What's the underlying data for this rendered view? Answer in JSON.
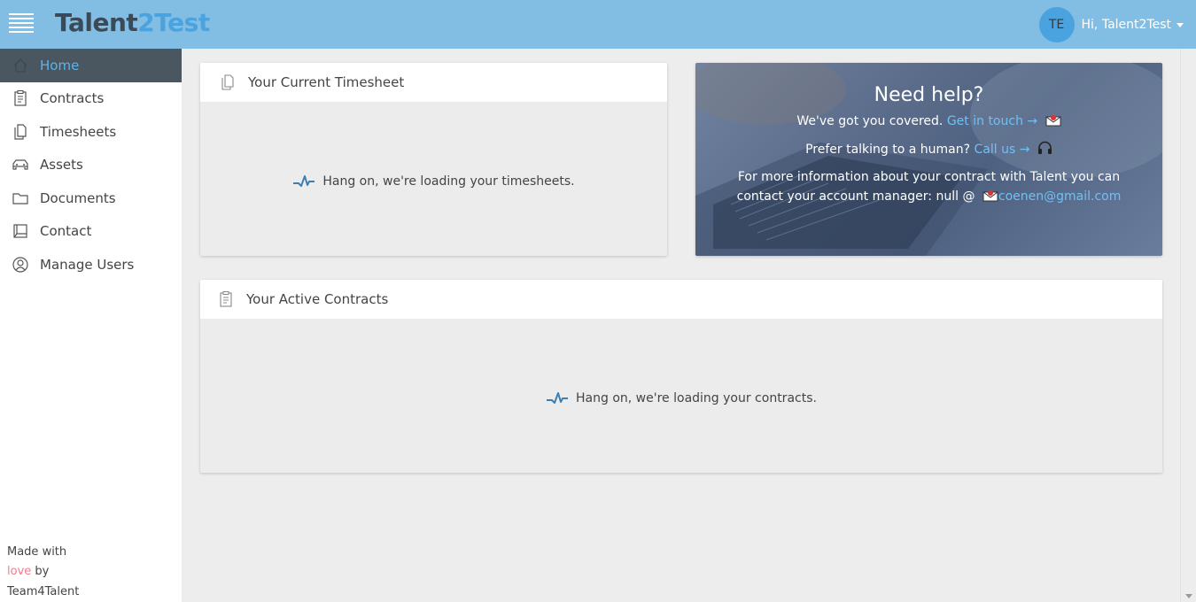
{
  "header": {
    "logo_part1": "Talent",
    "logo_part2": "2Test",
    "avatar_initials": "TE",
    "greeting": "Hi, Talent2Test"
  },
  "sidebar": {
    "items": [
      {
        "label": "Home",
        "icon": "home-icon"
      },
      {
        "label": "Contracts",
        "icon": "contracts-icon"
      },
      {
        "label": "Timesheets",
        "icon": "timesheets-icon"
      },
      {
        "label": "Assets",
        "icon": "car-icon"
      },
      {
        "label": "Documents",
        "icon": "folder-icon"
      },
      {
        "label": "Contact",
        "icon": "book-icon"
      },
      {
        "label": "Manage Users",
        "icon": "user-icon"
      }
    ],
    "footer": {
      "line1": "Made with",
      "love": "love",
      "by": " by",
      "line3": "Team4Talent"
    }
  },
  "timesheet_card": {
    "title": "Your Current Timesheet",
    "loading_text": "Hang on, we're loading your timesheets."
  },
  "help_card": {
    "title": "Need help?",
    "line1_text": "We've got you covered.",
    "line1_link": "Get in touch →",
    "line2_text": "Prefer talking to a human?",
    "line2_link": "Call us →",
    "info_text": "For more information about your contract with Talent you can contact your account manager: null @",
    "info_email": "coenen@gmail.com"
  },
  "contracts_card": {
    "title": "Your Active Contracts",
    "loading_text": "Hang on, we're loading your contracts."
  },
  "colors": {
    "topbar": "#82bde3",
    "accent": "#4aa3df",
    "active_nav_bg": "#4a5761",
    "link": "#6fc0f5",
    "love": "#f47b8a"
  }
}
